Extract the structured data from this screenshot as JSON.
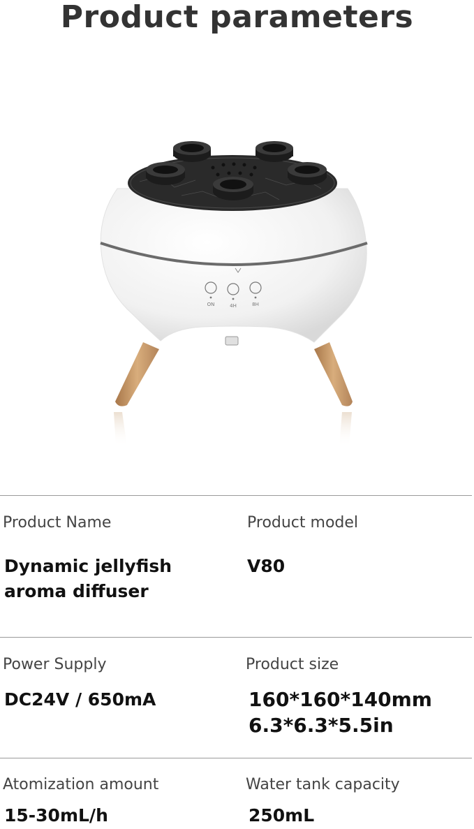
{
  "page": {
    "title": "Product parameters"
  },
  "product_image": {
    "control_labels": [
      "ON",
      "4H",
      "8H"
    ],
    "colors": {
      "body": "#f4f4f4",
      "top": "#2a2a2a",
      "band": "#6b6b6b",
      "wood": "#c99a66"
    }
  },
  "specs": {
    "product_name": {
      "label": "Product Name",
      "value_line1": "Dynamic jellyfish",
      "value_line2": "aroma diffuser"
    },
    "product_model": {
      "label": "Product model",
      "value": "V80"
    },
    "power_supply": {
      "label": "Power Supply",
      "value": "DC24V / 650mA"
    },
    "product_size": {
      "label": "Product size",
      "value_line1": "160*160*140mm",
      "value_line2": "6.3*6.3*5.5in"
    },
    "atomization": {
      "label": "Atomization amount",
      "value": "15-30mL/h"
    },
    "water_tank": {
      "label": "Water tank capacity",
      "value": "250mL"
    }
  }
}
